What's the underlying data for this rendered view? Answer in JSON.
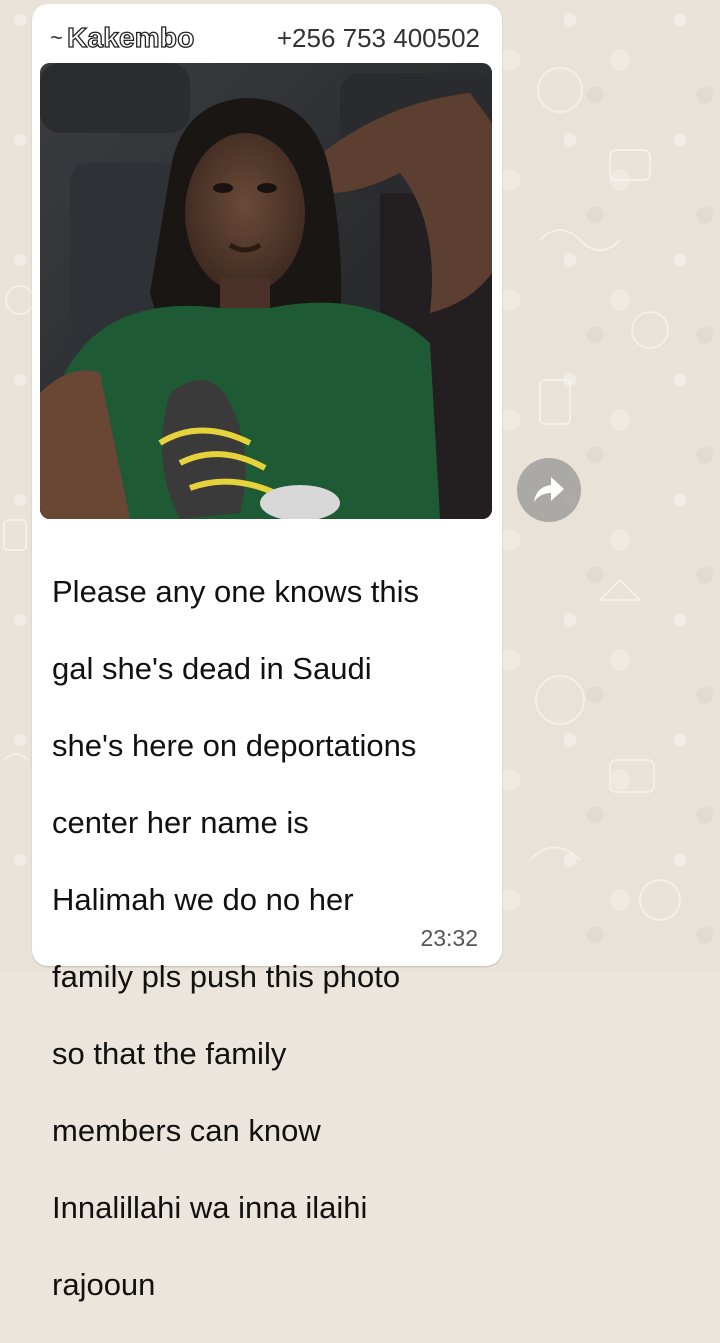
{
  "message": {
    "sender_name": "Kakembo",
    "sender_prefix": "~",
    "sender_phone": "+256 753 400502",
    "text_lines": [
      "Please any one knows this",
      "gal she's dead in Saudi",
      "she's here on deportations",
      "center her name is",
      "Halimah we do no her",
      "family pls push this photo",
      "so that the family",
      "members can know",
      "Innalillahi wa inna ilaihi",
      "rajooun"
    ],
    "time": "23:32",
    "image_icon": "photo-attachment"
  },
  "actions": {
    "forward_icon": "forward-arrow-icon"
  },
  "colors": {
    "bubble": "#ffffff",
    "wallpaper": "#e9e2d8",
    "forward_button": "#9a9a9a"
  }
}
